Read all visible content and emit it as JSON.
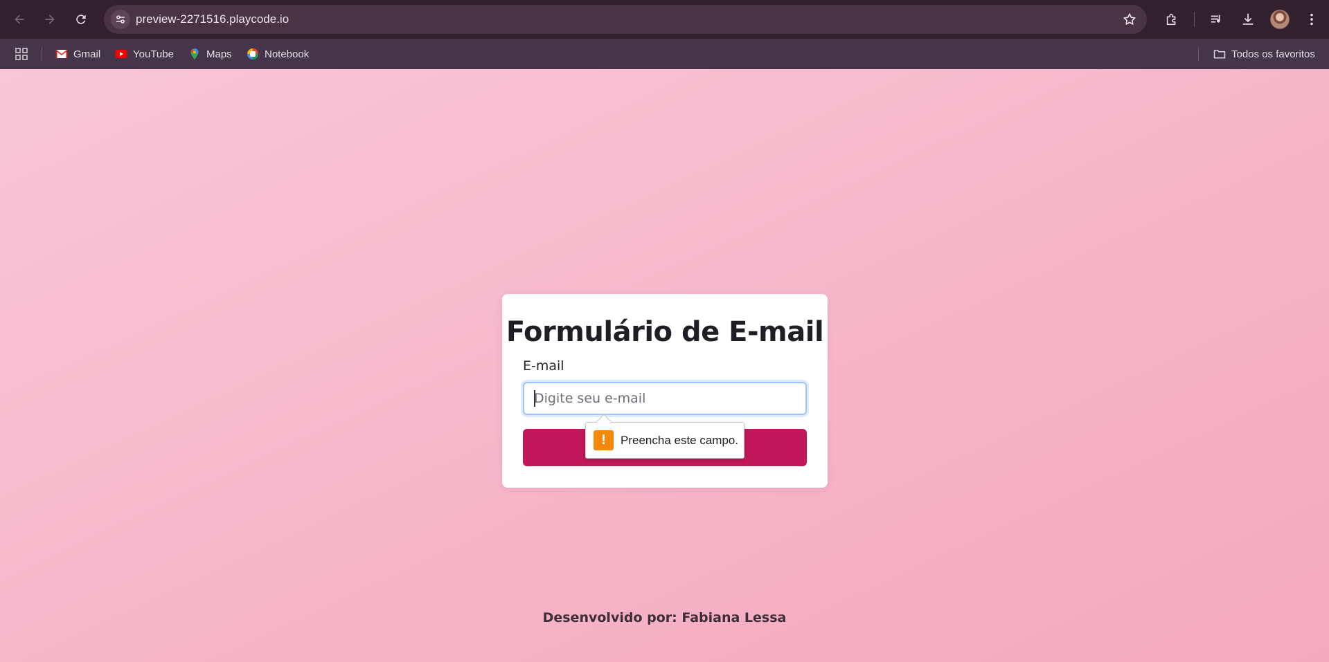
{
  "browser": {
    "url": "preview-2271516.playcode.io",
    "icons": {
      "back": "arrow-left-icon",
      "forward": "arrow-right-icon",
      "reload": "reload-icon",
      "site_info": "tune-icon",
      "bookmark": "star-icon",
      "extensions": "puzzle-icon",
      "media": "playlist-icon",
      "downloads": "download-icon",
      "menu": "kebab-menu-icon"
    }
  },
  "bookmarks": {
    "items": [
      {
        "label": "Gmail",
        "icon": "gmail-icon"
      },
      {
        "label": "YouTube",
        "icon": "youtube-icon"
      },
      {
        "label": "Maps",
        "icon": "maps-icon"
      },
      {
        "label": "Notebook",
        "icon": "notebook-icon"
      }
    ],
    "all_bookmarks": "Todos os favoritos"
  },
  "form": {
    "title": "Formulário de E-mail",
    "email_label": "E-mail",
    "email_value": "",
    "email_placeholder": "Digite seu e-mail",
    "submit_label": ""
  },
  "validation_tooltip": {
    "icon": "warning-icon",
    "glyph": "!",
    "message": "Preencha este campo."
  },
  "footer": {
    "text": "Desenvolvido por: Fabiana Lessa"
  },
  "colors": {
    "chrome_bg": "#33202f",
    "bookmarks_bg": "#46344a",
    "page_bg": "#f7b4c7",
    "button": "#c2185b",
    "warning": "#f5870b",
    "focus_ring": "#9ec5f8"
  }
}
